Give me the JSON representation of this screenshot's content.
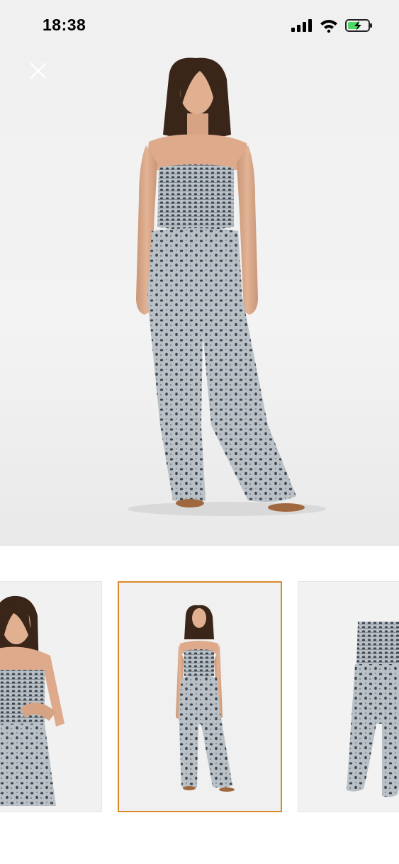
{
  "status_bar": {
    "time": "18:38",
    "icons": [
      "signal-icon",
      "wifi-icon",
      "battery-charging-icon"
    ]
  },
  "viewer": {
    "close_icon": "close-icon",
    "main_image": "jumpsuit-front-full-body-photo",
    "thumbnails": [
      {
        "name": "thumbnail-closeup",
        "selected": false
      },
      {
        "name": "thumbnail-full-body",
        "selected": true
      },
      {
        "name": "thumbnail-flat-lay",
        "selected": false
      }
    ]
  },
  "colors": {
    "selected_border": "#d98a2b",
    "photo_background": "#f0f0f0",
    "fabric_base": "#b9c0c6",
    "fabric_print": "#3e4650"
  }
}
